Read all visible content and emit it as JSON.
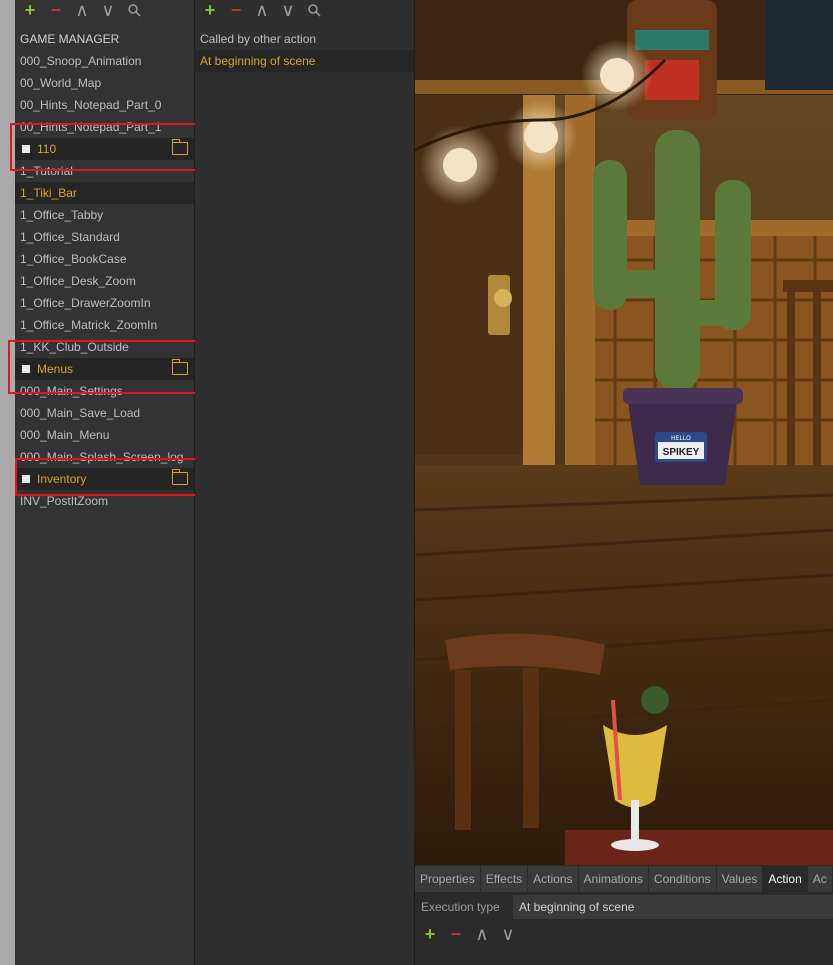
{
  "toolbar_icons": {
    "add": "+",
    "remove": "−",
    "up": "∧",
    "down": "∨",
    "search": "search-icon"
  },
  "scenes": {
    "root": "GAME MANAGER",
    "top_items": [
      "000_Snoop_Animation",
      "00_World_Map",
      "00_Hints_Notepad_Part_0",
      "00_Hints_Notepad_Part_1"
    ],
    "folder_110": {
      "label": "110",
      "items": [
        "1_Tutorial",
        "1_Tiki_Bar",
        "1_Office_Tabby",
        "1_Office_Standard",
        "1_Office_BookCase",
        "1_Office_Desk_Zoom",
        "1_Office_DrawerZoomIn",
        "1_Office_Matrick_ZoomIn",
        "1_KK_Club_Outside"
      ]
    },
    "folder_menus": {
      "label": "Menus",
      "items": [
        "000_Main_Settings",
        "000_Main_Save_Load",
        "000_Main_Menu",
        "000_Main_Splash_Screen_log"
      ]
    },
    "folder_inventory": {
      "label": "Inventory",
      "items": [
        "INV_PostItZoom"
      ]
    }
  },
  "actions": {
    "items": [
      "Called by other action",
      "At beginning of scene"
    ]
  },
  "scene_art": {
    "pot_label_1": "HELLO",
    "pot_label_2": "SPIKEY"
  },
  "props": {
    "tabs": [
      "Properties",
      "Effects",
      "Actions",
      "Animations",
      "Conditions",
      "Values",
      "Action",
      "Ac"
    ],
    "active_tab": "Action",
    "execution_type_label": "Execution type",
    "execution_type_value": "At beginning of scene"
  },
  "colors": {
    "accent": "#d9a227",
    "add": "#7cc33a",
    "remove": "#d22f2f",
    "highlight": "#e0161b"
  }
}
